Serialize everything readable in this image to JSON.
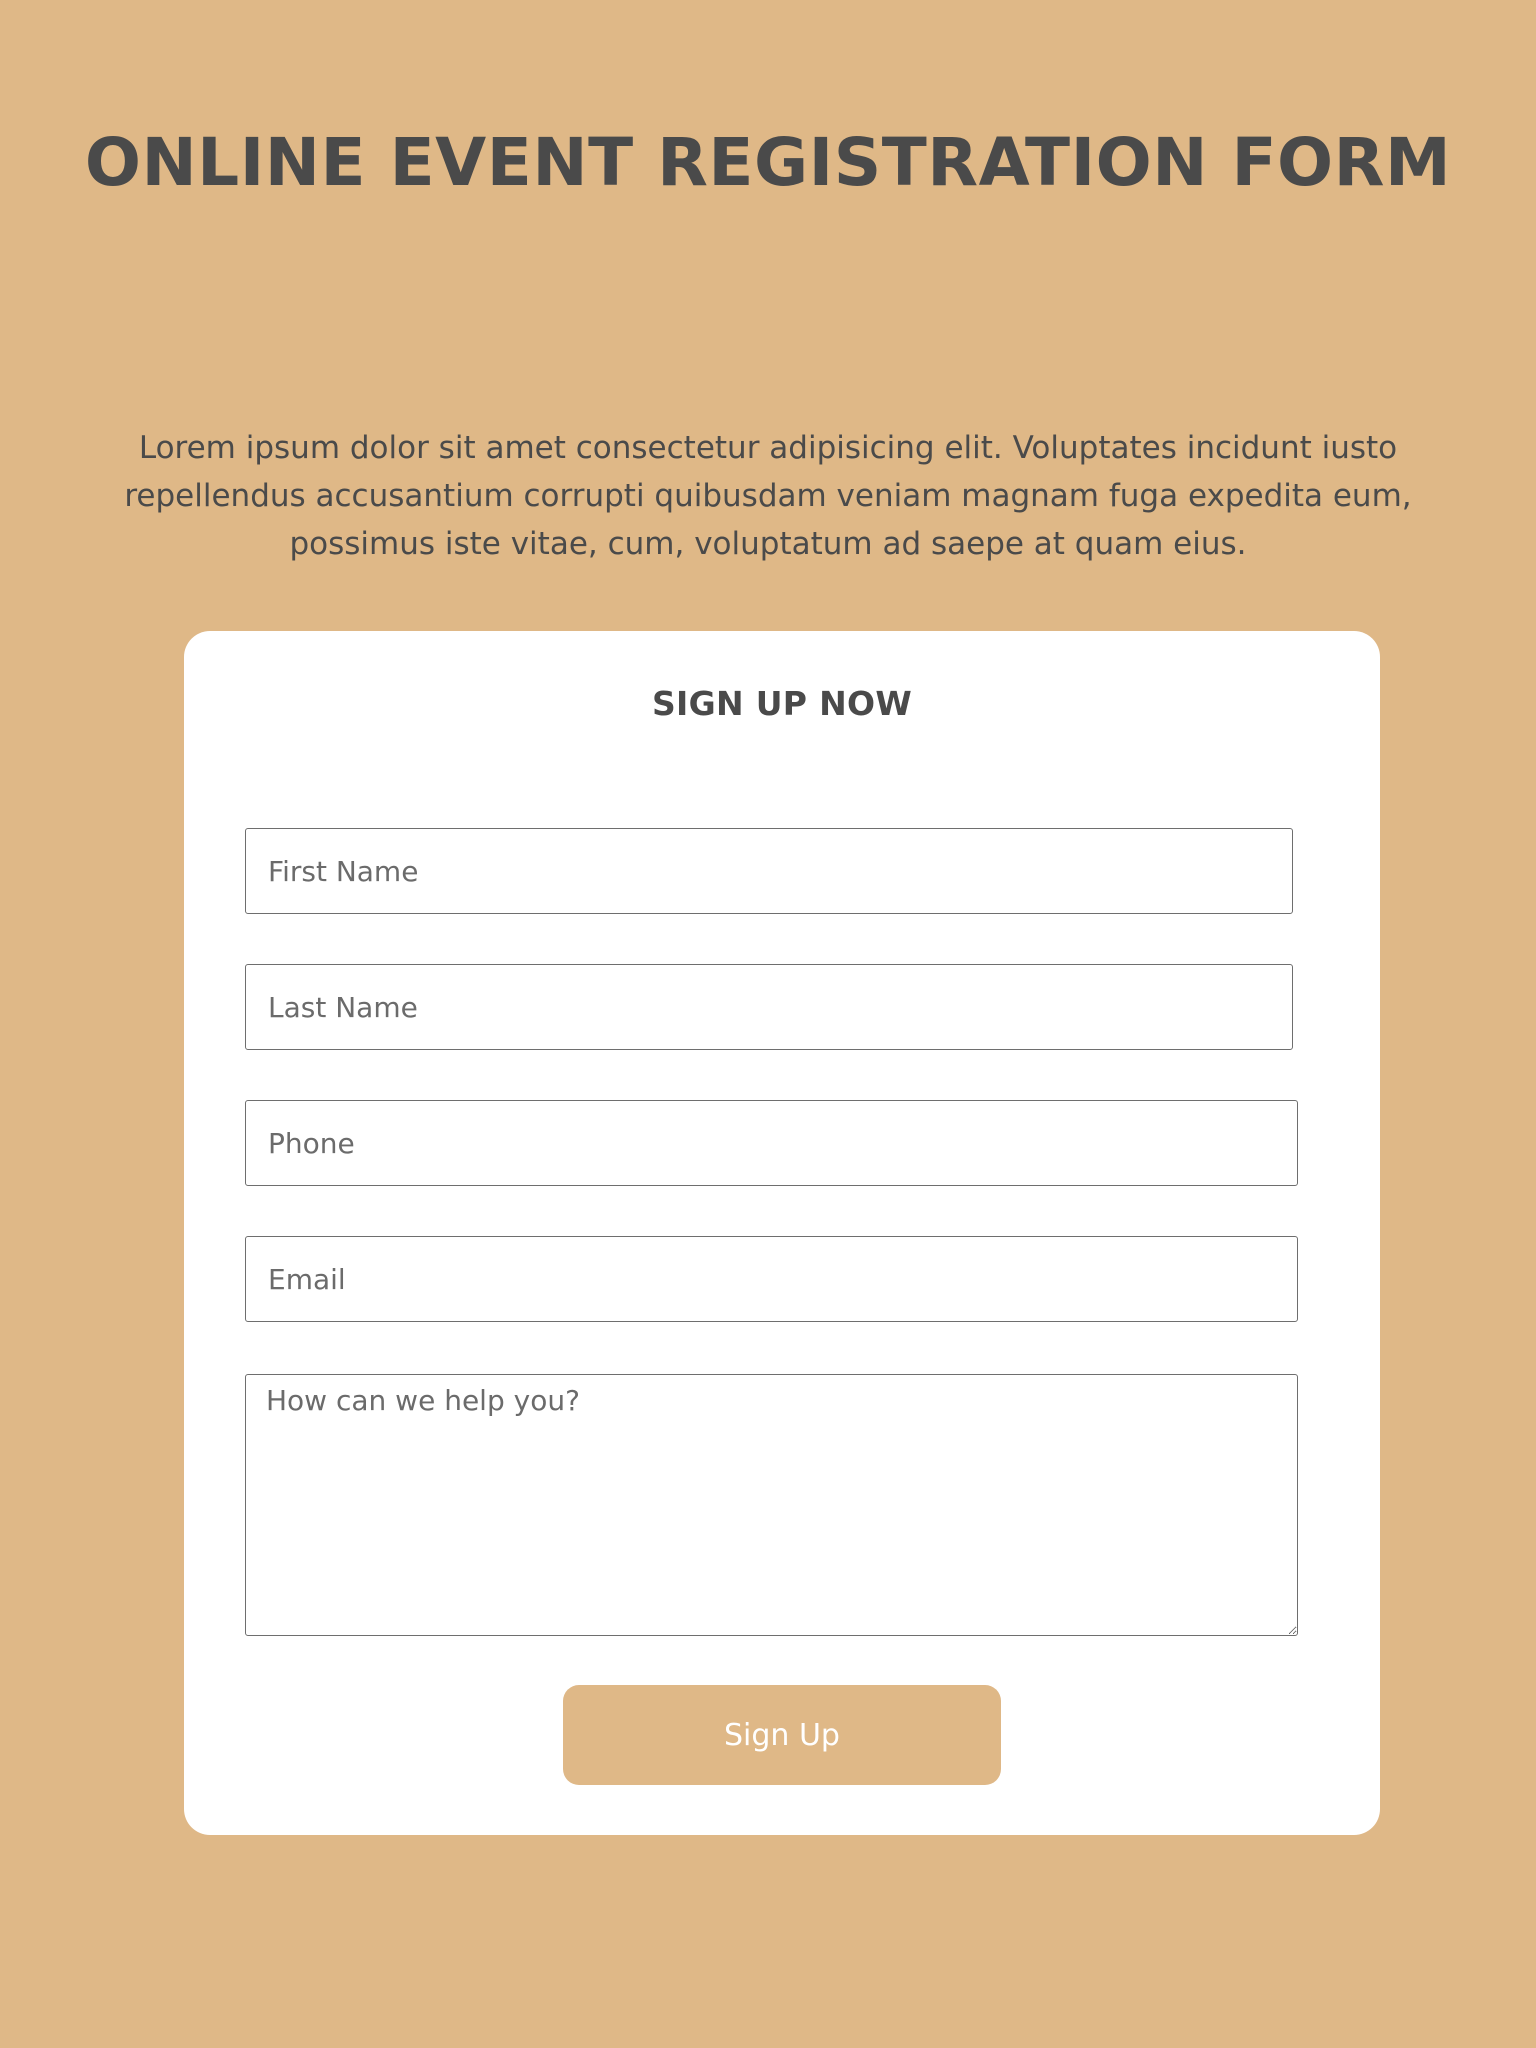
{
  "header": {
    "title": "ONLINE EVENT REGISTRATION FORM",
    "intro": "Lorem ipsum dolor sit amet consectetur adipisicing elit. Voluptates incidunt iusto repellendus accusantium corrupti quibusdam veniam magnam fuga expedita eum, possimus iste vitae, cum, voluptatum ad saepe at quam eius."
  },
  "form": {
    "title": "SIGN UP NOW",
    "first_name_placeholder": "First Name",
    "last_name_placeholder": "Last Name",
    "phone_placeholder": "Phone",
    "email_placeholder": "Email",
    "message_placeholder": "How can we help you?",
    "submit_label": "Sign Up"
  },
  "colors": {
    "background": "#dfb887",
    "card": "#ffffff",
    "text": "#4a4a4a",
    "button": "#dfb887",
    "button_text": "#ffffff"
  }
}
